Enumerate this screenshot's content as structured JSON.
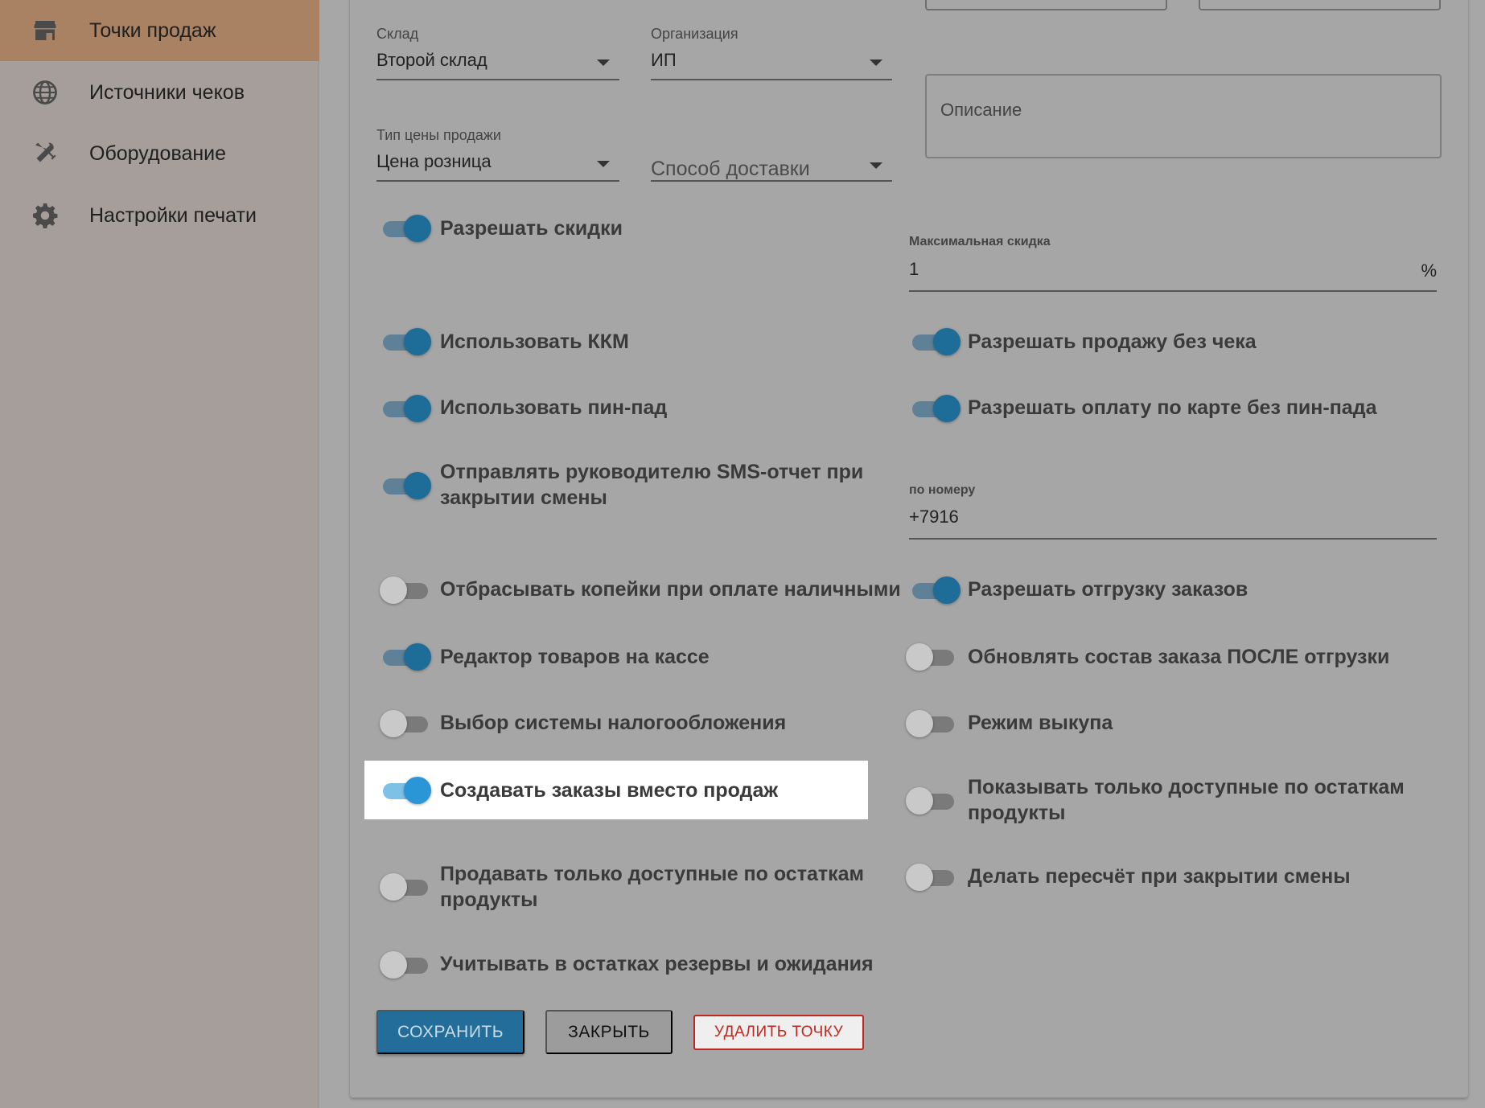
{
  "sidebar": {
    "items": [
      {
        "label": "Точки продаж",
        "icon": "store-icon",
        "active": true
      },
      {
        "label": "Источники чеков",
        "icon": "globe-icon",
        "active": false
      },
      {
        "label": "Оборудование",
        "icon": "tools-icon",
        "active": false
      },
      {
        "label": "Настройки печати",
        "icon": "gear-icon",
        "active": false
      }
    ]
  },
  "form": {
    "warehouse": {
      "label": "Склад",
      "value": "Второй склад"
    },
    "organization": {
      "label": "Организация",
      "value": "ИП"
    },
    "price_type": {
      "label": "Тип цены продажи",
      "value": "Цена розница"
    },
    "delivery": {
      "placeholder": "Способ доставки"
    },
    "description": {
      "placeholder": "Описание"
    },
    "max_discount": {
      "label": "Максимальная скидка",
      "value": "1",
      "suffix": "%"
    },
    "phone": {
      "label": "по номеру",
      "value": "+7916"
    }
  },
  "toggles": {
    "allow_discounts": {
      "label": "Разрешать скидки",
      "on": true
    },
    "use_kkm": {
      "label": "Использовать ККМ",
      "on": true
    },
    "allow_no_receipt": {
      "label": "Разрешать продажу без чека",
      "on": true
    },
    "use_pinpad": {
      "label": "Использовать пин-пад",
      "on": true
    },
    "allow_card_no_pinpad": {
      "label": "Разрешать оплату по карте без пин-пада",
      "on": true
    },
    "sms_report_1": {
      "label": "Отправлять руководителю SMS-отчет при",
      "on": true
    },
    "sms_report_2": {
      "label": "закрытии смены"
    },
    "drop_kopecks": {
      "label": "Отбрасывать копейки при оплате наличными",
      "on": false
    },
    "allow_order_shipping": {
      "label": "Разрешать отгрузку заказов",
      "on": true
    },
    "product_editor": {
      "label": "Редактор товаров на кассе",
      "on": true
    },
    "update_after_shipping": {
      "label": "Обновлять состав заказа ПОСЛЕ отгрузки",
      "on": false
    },
    "tax_system": {
      "label": "Выбор системы налогообложения",
      "on": false
    },
    "buyout_mode": {
      "label": "Режим выкупа",
      "on": false
    },
    "create_orders": {
      "label": "Создавать заказы вместо продаж",
      "on": true
    },
    "show_available_1": {
      "label": "Показывать только доступные по остаткам",
      "on": false
    },
    "show_available_2": {
      "label": "продукты"
    },
    "recount_on_close": {
      "label": "Делать пересчёт при закрытии смены",
      "on": false
    },
    "sell_available_1": {
      "label": "Продавать только доступные по остаткам",
      "on": false
    },
    "sell_available_2": {
      "label": "продукты"
    },
    "reserves": {
      "label": "Учитывать в остатках резервы и ожидания",
      "on": false
    }
  },
  "buttons": {
    "save": "СОХРАНИТЬ",
    "close": "ЗАКРЫТЬ",
    "delete": "УДАЛИТЬ ТОЧКУ"
  },
  "colors": {
    "accent": "#1e6d99",
    "sidebar_active": "#a88262",
    "danger": "#c0281e"
  }
}
